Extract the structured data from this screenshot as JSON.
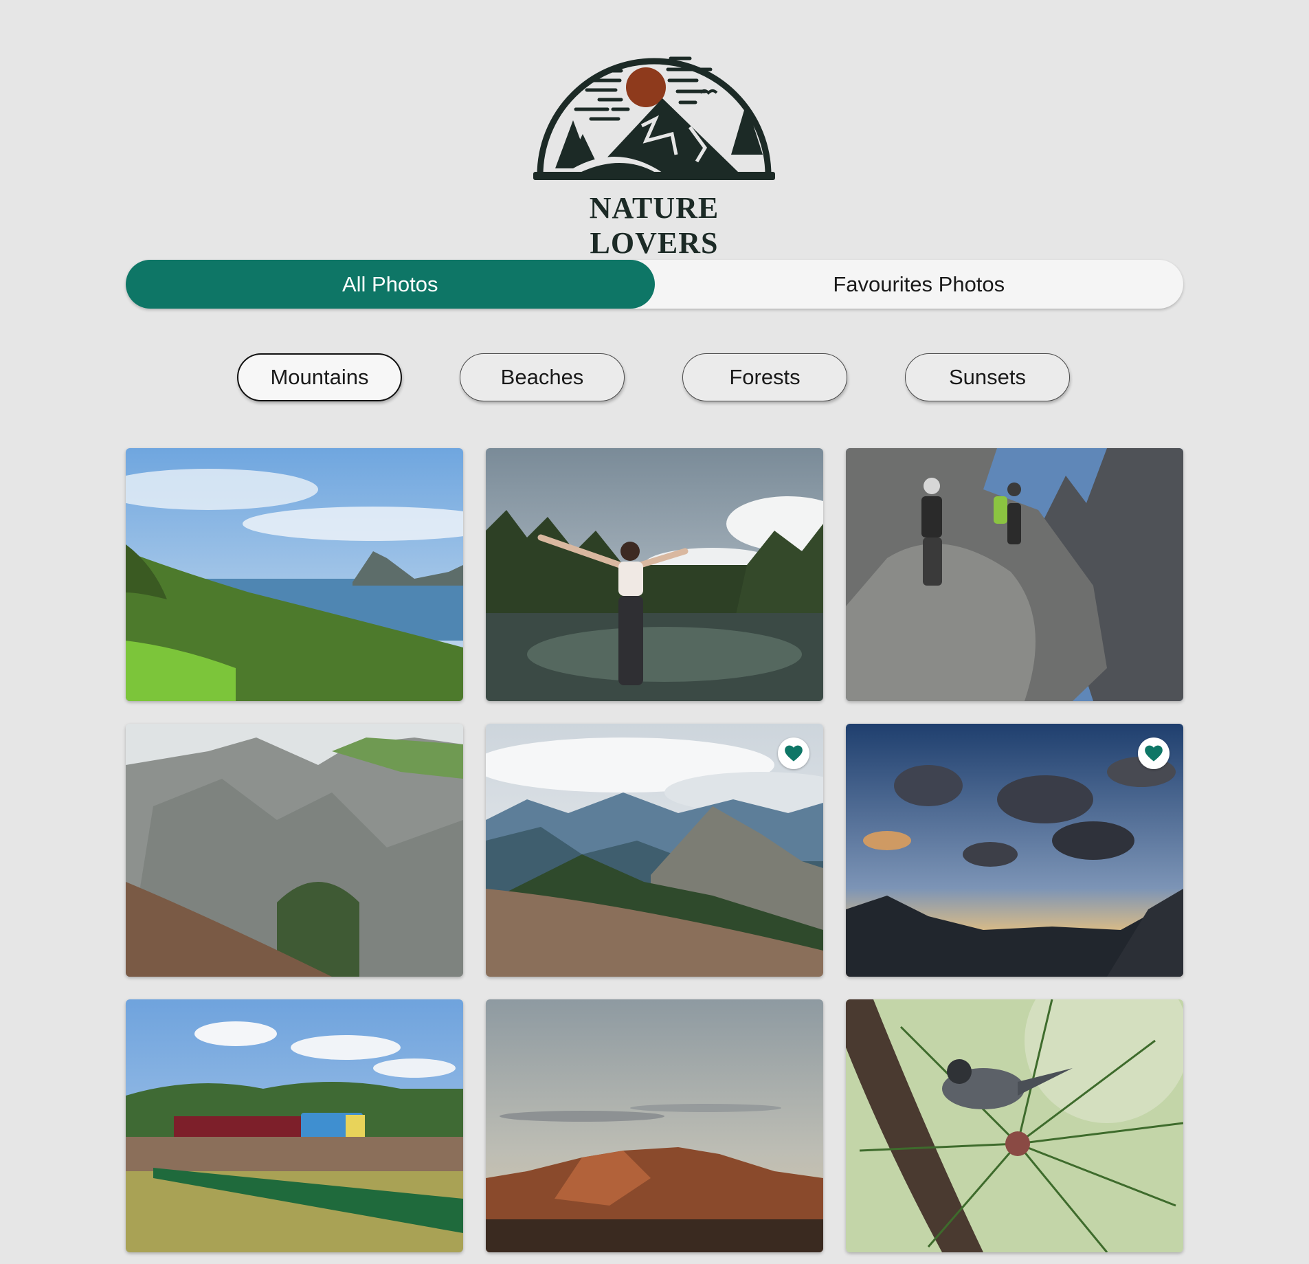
{
  "brand": {
    "logo_text": "NATURE LOVERS",
    "logo_icon": "mountain-sun-logo-icon"
  },
  "tabs": [
    {
      "label": "All Photos",
      "active": true
    },
    {
      "label": "Favourites Photos",
      "active": false
    }
  ],
  "categories": [
    {
      "label": "Mountains",
      "selected": true
    },
    {
      "label": "Beaches",
      "selected": false
    },
    {
      "label": "Forests",
      "selected": false
    },
    {
      "label": "Sunsets",
      "selected": false
    }
  ],
  "photos": [
    {
      "subject": "coastal hills overlooking ocean",
      "favourite": false
    },
    {
      "subject": "hiker with raised arms at mountain lake",
      "favourite": false
    },
    {
      "subject": "two climbers on rocky cliff",
      "favourite": false
    },
    {
      "subject": "grey rocky mountain face",
      "favourite": false
    },
    {
      "subject": "alpine valley under cloudy sky",
      "favourite": true
    },
    {
      "subject": "sunset clouds over peaks",
      "favourite": true
    },
    {
      "subject": "blue train passing green fence",
      "favourite": false
    },
    {
      "subject": "mountain ridge at dusk",
      "favourite": false
    },
    {
      "subject": "bird perched in pine needles",
      "favourite": false
    }
  ],
  "icons": {
    "favourite": "heart-icon"
  },
  "colors": {
    "accent": "#0e7666",
    "background": "#e6e6e6",
    "logo_sun": "#8e3a1c",
    "logo_dark": "#1c2a26"
  }
}
